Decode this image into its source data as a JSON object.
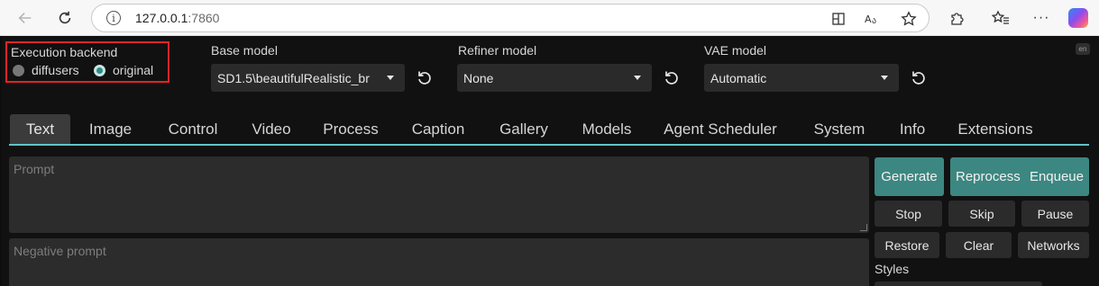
{
  "browser": {
    "address_host": "127.0.0.1",
    "address_port": ":7860",
    "icons": [
      "back-arrow-icon",
      "reload-icon",
      "site-info-icon",
      "split-screen-icon",
      "read-aloud-icon",
      "favorite-star-icon",
      "extensions-icon",
      "favorites-icon",
      "more-icon",
      "copilot-icon"
    ]
  },
  "lang_badge": "en",
  "backend": {
    "label": "Execution backend",
    "options": [
      "diffusers",
      "original"
    ],
    "selected": "original"
  },
  "models": {
    "base": {
      "label": "Base model",
      "value": "SD1.5\\beautifulRealistic_br"
    },
    "refiner": {
      "label": "Refiner model",
      "value": "None"
    },
    "vae": {
      "label": "VAE model",
      "value": "Automatic"
    }
  },
  "tabs": [
    "Text",
    "Image",
    "Control",
    "Video",
    "Process",
    "Caption",
    "Gallery",
    "Models",
    "Agent Scheduler",
    "System",
    "Info",
    "Extensions"
  ],
  "active_tab": "Text",
  "prompt": {
    "placeholder": "Prompt"
  },
  "negative_prompt": {
    "placeholder": "Negative prompt"
  },
  "actions": {
    "generate": "Generate",
    "reprocess": "Reprocess",
    "enqueue": "Enqueue",
    "stop": "Stop",
    "skip": "Skip",
    "pause": "Pause",
    "restore": "Restore",
    "clear": "Clear",
    "networks": "Networks"
  },
  "styles_label": "Styles",
  "colors": {
    "accent": "#5fc4c7",
    "button_primary": "#3c8781",
    "highlight_box": "#e12525"
  }
}
